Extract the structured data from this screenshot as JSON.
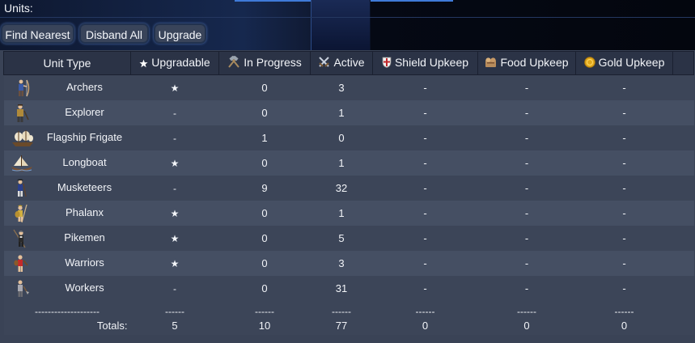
{
  "window": {
    "title": "Units:"
  },
  "toolbar": {
    "find_label": "Find Nearest",
    "disband_label": "Disband All",
    "upgrade_label": "Upgrade"
  },
  "table": {
    "headers": {
      "unit_type": "Unit Type",
      "upgradable": "Upgradable",
      "in_progress": "In Progress",
      "active": "Active",
      "shield_upkeep": "Shield Upkeep",
      "food_upkeep": "Food Upkeep",
      "gold_upkeep": "Gold Upkeep"
    },
    "header_icons": {
      "upgradable": "star-icon",
      "in_progress": "hammers-icon",
      "active": "crossed-swords-icon",
      "shield_upkeep": "shield-icon",
      "food_upkeep": "food-icon",
      "gold_upkeep": "gold-coin-icon"
    },
    "rows": [
      {
        "name": "Archers",
        "icon": "archer-icon",
        "upgradable": "★",
        "in_progress": "0",
        "active": "3",
        "shield": "-",
        "food": "-",
        "gold": "-"
      },
      {
        "name": "Explorer",
        "icon": "explorer-icon",
        "upgradable": "-",
        "in_progress": "0",
        "active": "1",
        "shield": "-",
        "food": "-",
        "gold": "-"
      },
      {
        "name": "Flagship Frigate",
        "icon": "frigate-icon",
        "upgradable": "-",
        "in_progress": "1",
        "active": "0",
        "shield": "-",
        "food": "-",
        "gold": "-"
      },
      {
        "name": "Longboat",
        "icon": "longboat-icon",
        "upgradable": "★",
        "in_progress": "0",
        "active": "1",
        "shield": "-",
        "food": "-",
        "gold": "-"
      },
      {
        "name": "Musketeers",
        "icon": "musketeer-icon",
        "upgradable": "-",
        "in_progress": "9",
        "active": "32",
        "shield": "-",
        "food": "-",
        "gold": "-"
      },
      {
        "name": "Phalanx",
        "icon": "phalanx-icon",
        "upgradable": "★",
        "in_progress": "0",
        "active": "1",
        "shield": "-",
        "food": "-",
        "gold": "-"
      },
      {
        "name": "Pikemen",
        "icon": "pikemen-icon",
        "upgradable": "★",
        "in_progress": "0",
        "active": "5",
        "shield": "-",
        "food": "-",
        "gold": "-"
      },
      {
        "name": "Warriors",
        "icon": "warrior-icon",
        "upgradable": "★",
        "in_progress": "0",
        "active": "3",
        "shield": "-",
        "food": "-",
        "gold": "-"
      },
      {
        "name": "Workers",
        "icon": "worker-icon",
        "upgradable": "-",
        "in_progress": "0",
        "active": "31",
        "shield": "-",
        "food": "-",
        "gold": "-"
      }
    ],
    "separator": {
      "name": "--------------------",
      "col": "------"
    },
    "totals": {
      "label": "Totals:",
      "upgradable": "5",
      "in_progress": "10",
      "active": "77",
      "shield": "0",
      "food": "0",
      "gold": "0"
    }
  },
  "colors": {
    "header_bg": "#2b3346",
    "row_odd": "#3c4558",
    "row_even": "#454f63",
    "accent_blue": "#3f7ad8",
    "shield_red": "#c0282c",
    "gold": "#e0a81c"
  }
}
